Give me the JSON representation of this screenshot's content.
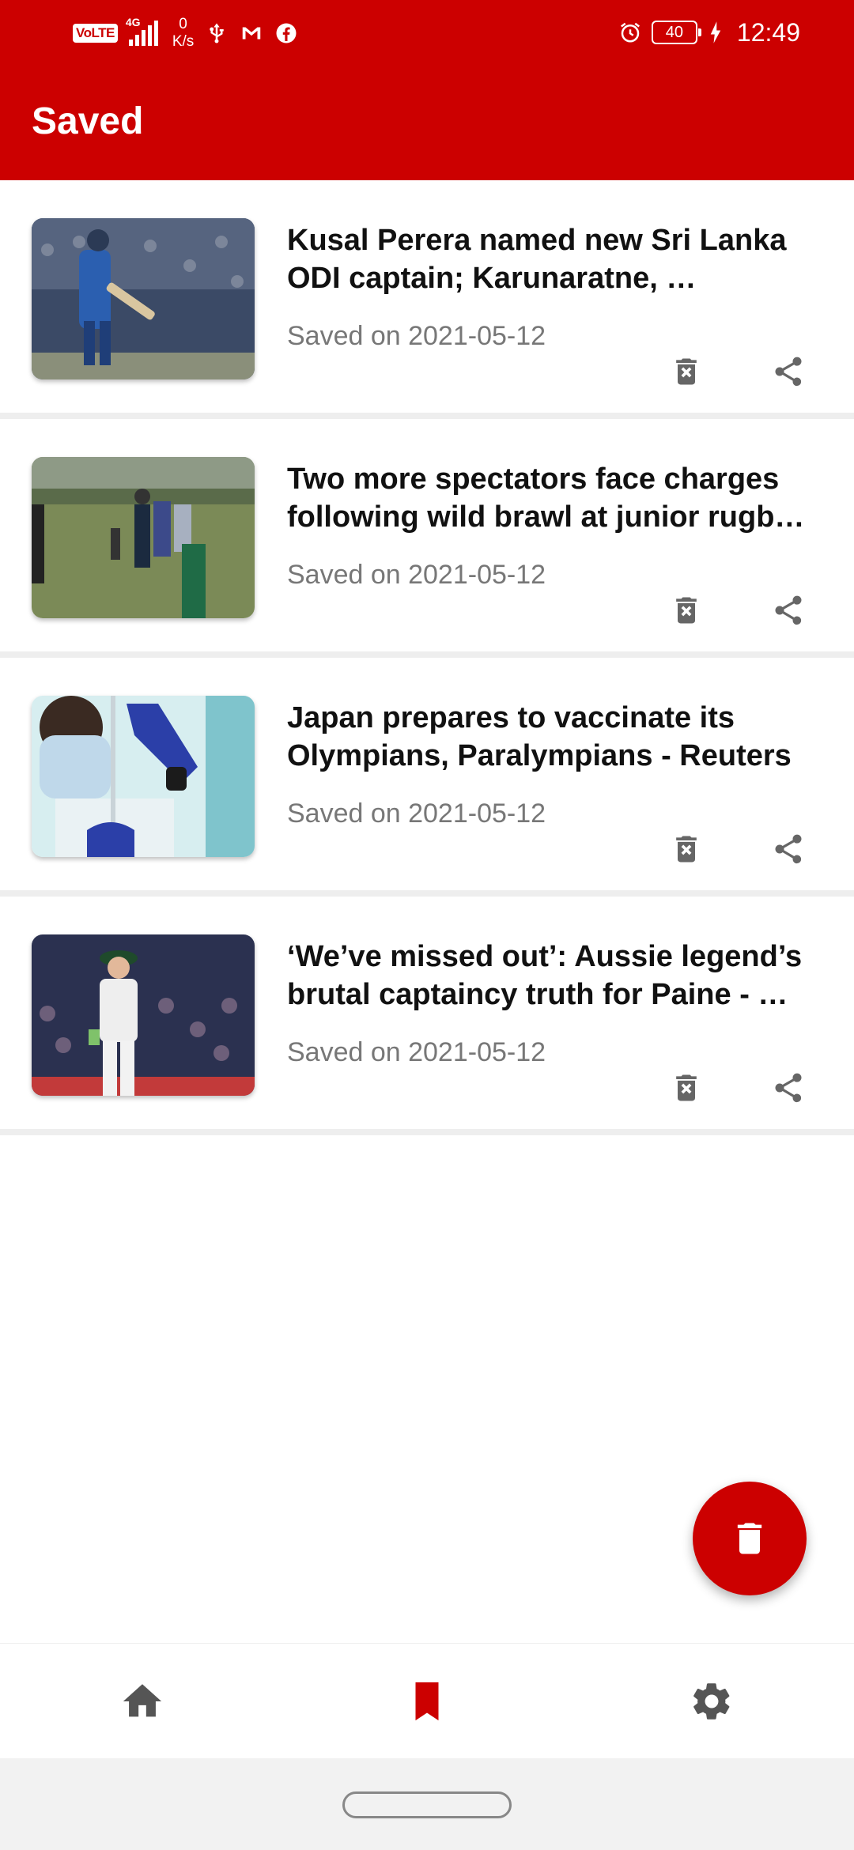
{
  "status_bar": {
    "volte": "VoLTE",
    "network": "4G",
    "speed_value": "0",
    "speed_unit": "K/s",
    "battery": "40",
    "time": "12:49",
    "icons": [
      "usb-icon",
      "gmail-icon",
      "facebook-icon",
      "alarm-icon",
      "charging-icon"
    ]
  },
  "app_bar": {
    "title": "Saved"
  },
  "articles": [
    {
      "title": "Kusal Perera named new Sri Lanka ODI captain; Karunaratne, …",
      "saved": "Saved on 2021-05-12"
    },
    {
      "title": "Two more spectators face charges following wild brawl at junior rugb…",
      "saved": "Saved on 2021-05-12"
    },
    {
      "title": "Japan prepares to vaccinate its Olympians, Paralympians - Reuters",
      "saved": "Saved on 2021-05-12"
    },
    {
      "title": "‘We’ve missed out’: Aussie legend’s brutal captaincy truth for Paine - …",
      "saved": "Saved on 2021-05-12"
    }
  ],
  "fab": {
    "icon": "delete-all-icon"
  },
  "bottom_nav": {
    "items": [
      {
        "icon": "home-icon",
        "active": false
      },
      {
        "icon": "bookmark-icon",
        "active": true
      },
      {
        "icon": "settings-icon",
        "active": false
      }
    ]
  },
  "colors": {
    "primary": "#cc0000",
    "inactive_icon": "#555555",
    "secondary_text": "#777777"
  }
}
